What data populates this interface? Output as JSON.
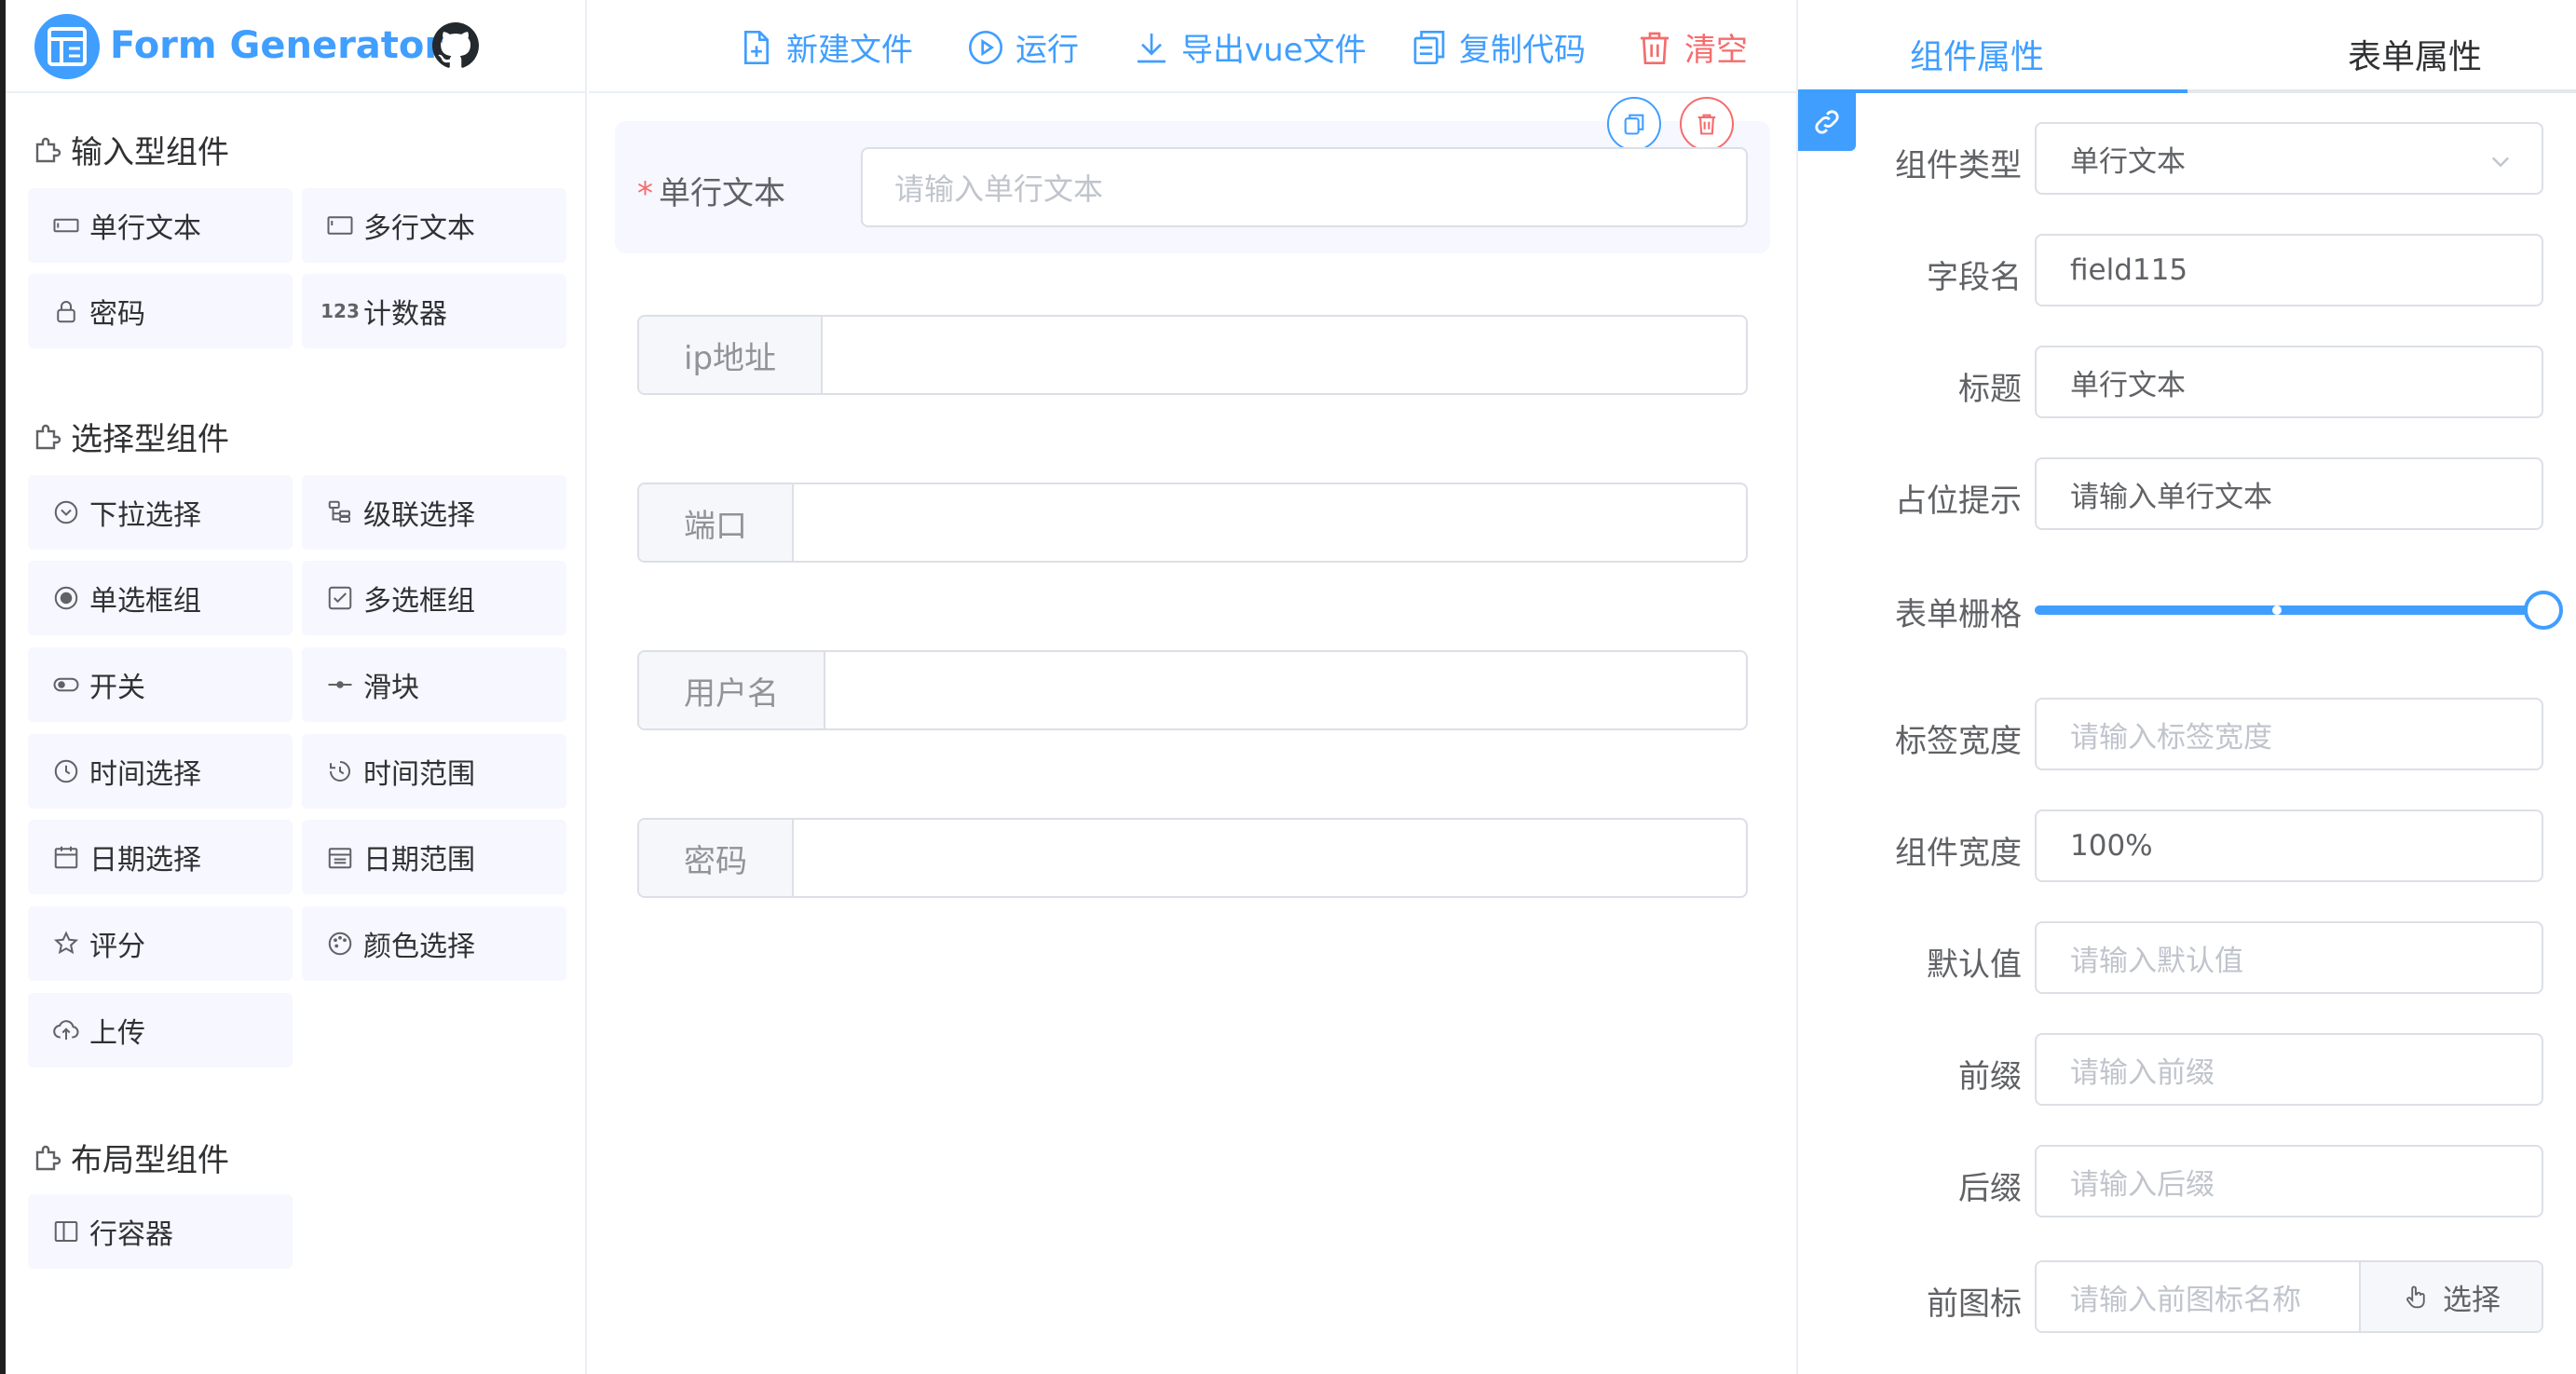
{
  "app": {
    "title": "Form Generator"
  },
  "toolbar": {
    "new_file": "新建文件",
    "run": "运行",
    "export_vue": "导出vue文件",
    "copy_code": "复制代码",
    "clear": "清空"
  },
  "sidebar": {
    "sections": [
      {
        "title": "输入型组件",
        "items": [
          "单行文本",
          "多行文本",
          "密码",
          "计数器"
        ]
      },
      {
        "title": "选择型组件",
        "items": [
          "下拉选择",
          "级联选择",
          "单选框组",
          "多选框组",
          "开关",
          "滑块",
          "时间选择",
          "时间范围",
          "日期选择",
          "日期范围",
          "评分",
          "颜色选择",
          "上传"
        ]
      },
      {
        "title": "布局型组件",
        "items": [
          "行容器"
        ]
      }
    ]
  },
  "canvas": {
    "active_field": {
      "label": "单行文本",
      "placeholder": "请输入单行文本"
    },
    "fields": [
      {
        "prepend": "ip地址"
      },
      {
        "prepend": "端口"
      },
      {
        "prepend": "用户名"
      },
      {
        "prepend": "密码"
      }
    ]
  },
  "right_panel": {
    "tabs": [
      "组件属性",
      "表单属性"
    ],
    "props": {
      "type_label": "组件类型",
      "type_value": "单行文本",
      "field_label": "字段名",
      "field_value": "field115",
      "title_label": "标题",
      "title_value": "单行文本",
      "placeholder_label": "占位提示",
      "placeholder_value": "请输入单行文本",
      "span_label": "表单栅格",
      "span_value": 24,
      "span_max": 24,
      "label_width_label": "标签宽度",
      "label_width_ph": "请输入标签宽度",
      "comp_width_label": "组件宽度",
      "comp_width_value": "100%",
      "default_label": "默认值",
      "default_ph": "请输入默认值",
      "prefix_label": "前缀",
      "prefix_ph": "请输入前缀",
      "suffix_label": "后缀",
      "suffix_ph": "请输入后缀",
      "prefix_icon_label": "前图标",
      "prefix_icon_ph": "请输入前图标名称",
      "select_btn": "选择"
    }
  },
  "colors": {
    "primary": "#409eff",
    "danger": "#f56c6c",
    "item_bg": "#f6f7ff"
  }
}
